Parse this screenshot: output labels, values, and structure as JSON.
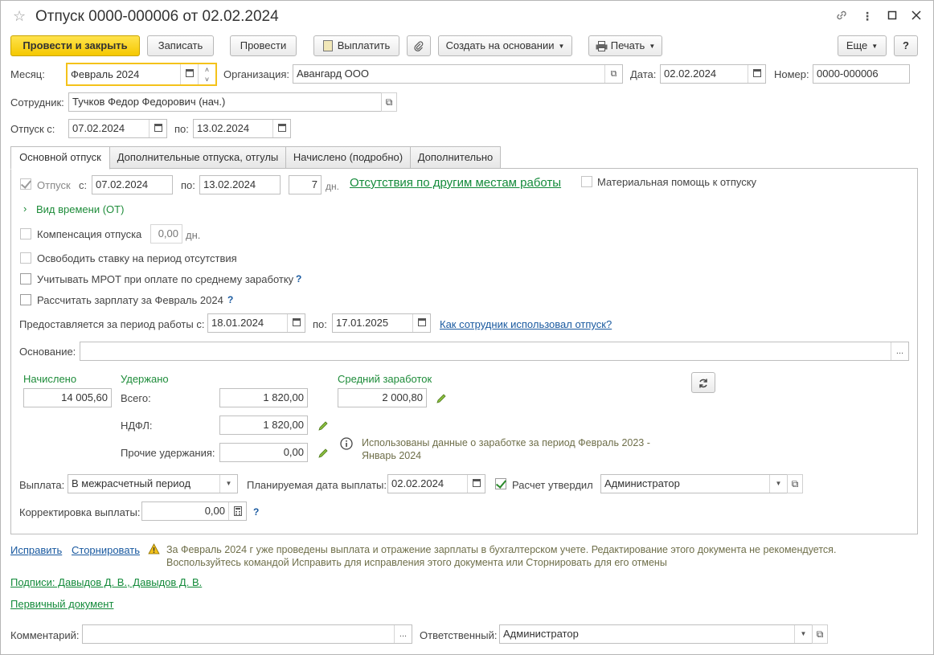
{
  "window": {
    "title": "Отпуск 0000-000006 от 02.02.2024"
  },
  "toolbar": {
    "post_close": "Провести и закрыть",
    "save": "Записать",
    "post": "Провести",
    "pay": "Выплатить",
    "create_based": "Создать на основании",
    "print": "Печать",
    "more": "Еще",
    "help": "?"
  },
  "header": {
    "month_label": "Месяц:",
    "month_value": "Февраль 2024",
    "org_label": "Организация:",
    "org_value": "Авангард ООО",
    "date_label": "Дата:",
    "date_value": "02.02.2024",
    "number_label": "Номер:",
    "number_value": "0000-000006",
    "employee_label": "Сотрудник:",
    "employee_value": "Тучков Федор Федорович (нач.)",
    "vac_from_label": "Отпуск с:",
    "vac_from_value": "07.02.2024",
    "vac_to_label": "по:",
    "vac_to_value": "13.02.2024"
  },
  "tabs": [
    {
      "label": "Основной отпуск"
    },
    {
      "label": "Дополнительные отпуска, отгулы"
    },
    {
      "label": "Начислено (подробно)"
    },
    {
      "label": "Дополнительно"
    }
  ],
  "main": {
    "vac_check_label": "Отпуск",
    "vac_from_label": "с:",
    "vac_from": "07.02.2024",
    "vac_to_label": "по:",
    "vac_to": "13.02.2024",
    "days": "7",
    "days_unit": "дн.",
    "absence_link": "Отсутствия по другим местам работы",
    "material_help": "Материальная помощь к отпуску",
    "time_type": "Вид времени (ОТ)",
    "compensation_label": "Компенсация отпуска",
    "compensation_value": "0,00",
    "compensation_unit": "дн.",
    "free_rate": "Освободить ставку на период отсутствия",
    "mrot": "Учитывать МРОТ при оплате по среднему заработку",
    "calc_salary": "Рассчитать зарплату за Февраль 2024",
    "period_label": "Предоставляется за период работы с:",
    "period_from": "18.01.2024",
    "period_to_label": "по:",
    "period_to": "17.01.2025",
    "how_used_link": "Как сотрудник использовал отпуск?",
    "basis_label": "Основание:",
    "basis_value": "",
    "accrued_label": "Начислено",
    "accrued_value": "14 005,60",
    "withheld_label": "Удержано",
    "total_label": "Всего:",
    "total_value": "1 820,00",
    "ndfl_label": "НДФЛ:",
    "ndfl_value": "1 820,00",
    "other_label": "Прочие удержания:",
    "other_value": "0,00",
    "avg_label": "Средний заработок",
    "avg_value": "2 000,80",
    "info_text": "Использованы данные о заработке за период Февраль 2023 - Январь 2024",
    "payout_label": "Выплата:",
    "payout_value": "В межрасчетный период",
    "plan_date_label": "Планируемая дата выплаты:",
    "plan_date_value": "02.02.2024",
    "approved_label": "Расчет утвердил",
    "approved_value": "Администратор",
    "correction_label": "Корректировка выплаты:",
    "correction_value": "0,00"
  },
  "footer": {
    "fix_link": "Исправить",
    "storno_link": "Сторнировать",
    "warning": "За Февраль 2024 г уже проведены выплата и отражение зарплаты в бухгалтерском учете. Редактирование этого документа не рекомендуется. Воспользуйтесь командой Исправить для исправления этого документа или Сторнировать для его отмены",
    "signatures_link": "Подписи: Давыдов Д. В., Давыдов Д. В.",
    "primary_doc_link": "Первичный документ",
    "comment_label": "Комментарий:",
    "comment_value": "",
    "responsible_label": "Ответственный:",
    "responsible_value": "Администратор"
  },
  "colors": {
    "primary_button": "#f5c800",
    "link_green": "#138a3a",
    "link_blue": "#1a5aa0",
    "focus_border": "#f4c21a"
  }
}
